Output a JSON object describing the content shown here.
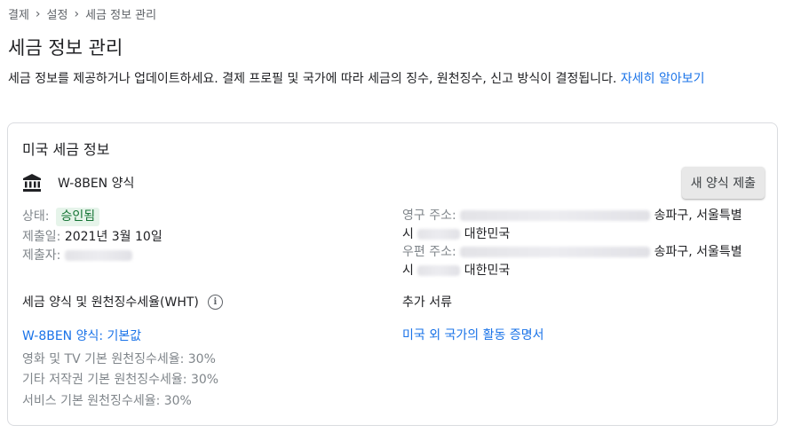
{
  "breadcrumb": [
    "결제",
    "설정",
    "세금 정보 관리"
  ],
  "page_title": "세금 정보 관리",
  "description": "세금 정보를 제공하거나 업데이트하세요. 결제 프로필 및 국가에 따라 세금의 징수, 원천징수, 신고 방식이 결정됩니다.",
  "learn_more": "자세히 알아보기",
  "card": {
    "title": "미국 세금 정보",
    "form_name": "W-8BEN 양식",
    "submit_button": "새 양식 제출",
    "status_label": "상태:",
    "status_value": "승인됨",
    "submit_date_label": "제출일:",
    "submit_date_value": "2021년 3월 10일",
    "submitter_label": "제출자:",
    "permanent_address_label": "영구 주소:",
    "permanent_address_line1_visible": "송파구, 서울특별",
    "permanent_address_line2_prefix": "시",
    "permanent_address_country": "대한민국",
    "mailing_address_label": "우편 주소:",
    "mailing_address_line1_visible": "송파구, 서울특별",
    "mailing_address_line2_prefix": "시",
    "mailing_address_country": "대한민국",
    "withholding_heading": "세금 양식 및 원천징수세율(WHT)",
    "info_icon": "i",
    "default_form_link": "W-8BEN 양식: 기본값",
    "rates": [
      "영화 및 TV 기본 원천징수세율: 30%",
      "기타 저작권 기본 원천징수세율: 30%",
      "서비스 기본 원천징수세율: 30%"
    ],
    "additional_docs_heading": "추가 서류",
    "additional_docs_link": "미국 외 국가의 활동 증명서"
  }
}
